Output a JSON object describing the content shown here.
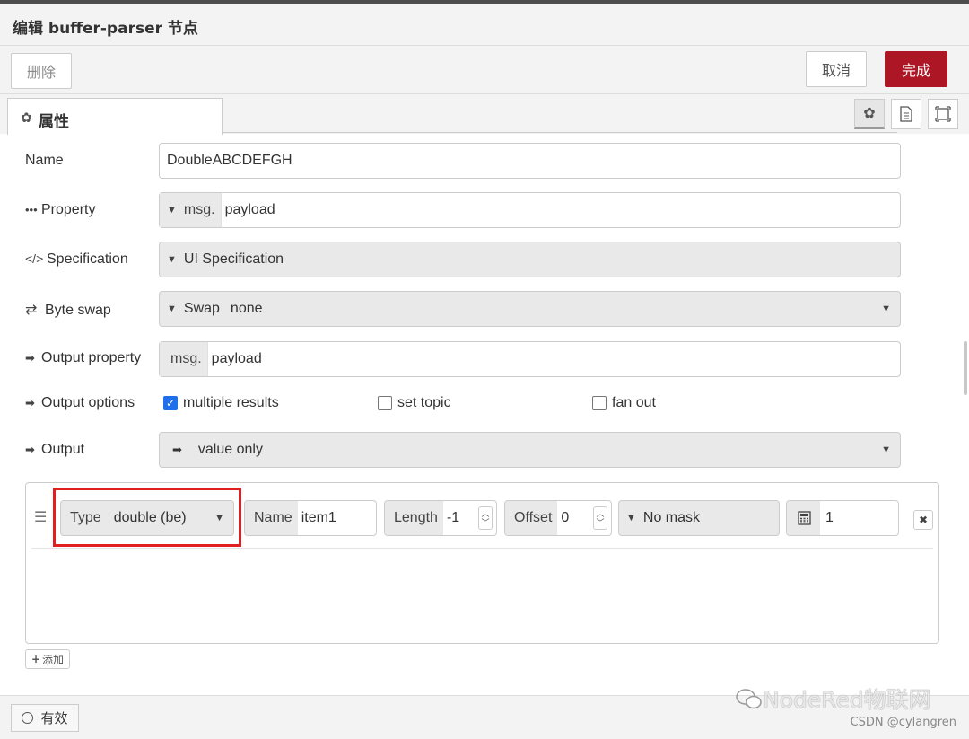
{
  "header": {
    "title": "编辑 buffer-parser 节点"
  },
  "buttons": {
    "delete": "删除",
    "cancel": "取消",
    "done": "完成"
  },
  "tab": {
    "label": "属性",
    "icon": "gear-icon"
  },
  "form": {
    "name": {
      "label": "Name",
      "value": "DoubleABCDEFGH"
    },
    "property": {
      "label": "Property",
      "type": "msg.",
      "value": "payload"
    },
    "specification": {
      "label": "Specification",
      "value": "UI Specification"
    },
    "byteswap": {
      "label": "Byte swap",
      "type": "Swap",
      "value": "none"
    },
    "output_property": {
      "label": "Output property",
      "type": "msg.",
      "value": "payload"
    },
    "output_options": {
      "label": "Output options",
      "multiple_results": {
        "label": "multiple results",
        "checked": true
      },
      "set_topic": {
        "label": "set topic",
        "checked": false
      },
      "fan_out": {
        "label": "fan out",
        "checked": false
      }
    },
    "output": {
      "label": "Output",
      "value": "value only"
    }
  },
  "item": {
    "type_label": "Type",
    "type_value": "double (be)",
    "name_label": "Name",
    "name_value": "item1",
    "length_label": "Length",
    "length_value": "-1",
    "offset_label": "Offset",
    "offset_value": "0",
    "mask_value": "No mask",
    "scale_value": "1"
  },
  "add_button": "添加",
  "footer": {
    "valid_label": "有效"
  },
  "watermark": "NodeRed物联网",
  "csdn": "CSDN @cylangren"
}
